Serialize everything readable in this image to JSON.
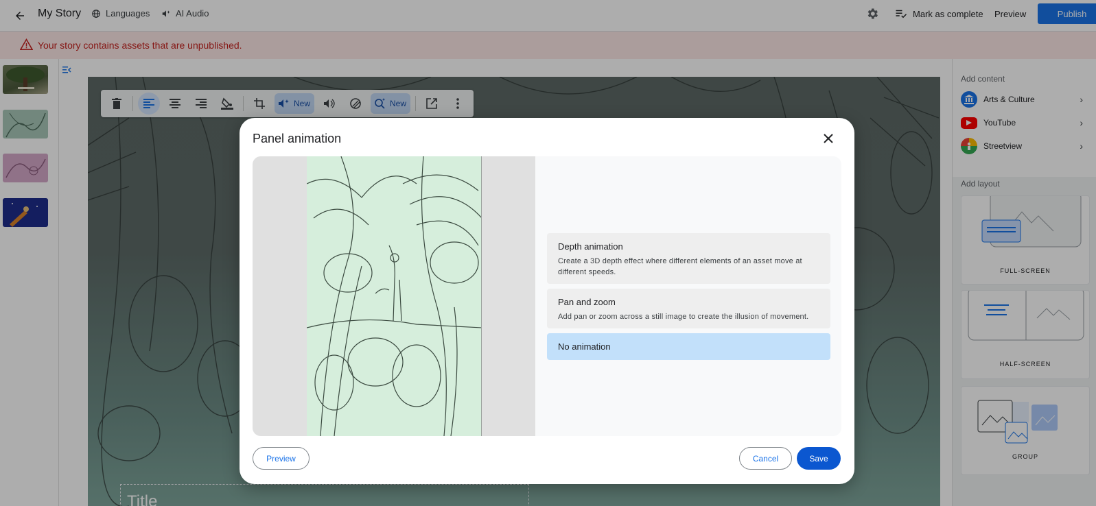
{
  "topbar": {
    "title": "My Story",
    "languages_label": "Languages",
    "ai_audio_label": "AI Audio",
    "mark_complete_label": "Mark as complete",
    "preview_label": "Preview",
    "publish_label": "Publish"
  },
  "banner": {
    "message": "Your story contains assets that are unpublished."
  },
  "toolbar": {
    "new_badge_1": "New",
    "new_badge_2": "New"
  },
  "canvas": {
    "title_placeholder": "Title"
  },
  "sidebar": {
    "add_content_heading": "Add content",
    "content_items": [
      {
        "label": "Arts & Culture",
        "icon": "arts-culture-logo-icon"
      },
      {
        "label": "YouTube",
        "icon": "youtube-logo-icon"
      },
      {
        "label": "Streetview",
        "icon": "streetview-logo-icon"
      }
    ],
    "add_layout_heading": "Add layout",
    "layouts": [
      {
        "label": "FULL-SCREEN"
      },
      {
        "label": "HALF-SCREEN"
      },
      {
        "label": "GROUP"
      }
    ]
  },
  "dialog": {
    "title": "Panel animation",
    "options": [
      {
        "title": "Depth animation",
        "description": "Create a 3D depth effect where different elements of an asset move at different speeds."
      },
      {
        "title": "Pan and zoom",
        "description": "Add pan or zoom across a still image to create the illusion of movement."
      },
      {
        "title": "No animation",
        "description": ""
      }
    ],
    "selected_option": "No animation",
    "preview_button": "Preview",
    "cancel_button": "Cancel",
    "save_button": "Save"
  },
  "colors": {
    "accent": "#1a73e8",
    "banner_bg": "#fce8e6",
    "banner_text": "#c5221f",
    "selected_option": "#c2e0fa",
    "save_button": "#0b57d0"
  }
}
